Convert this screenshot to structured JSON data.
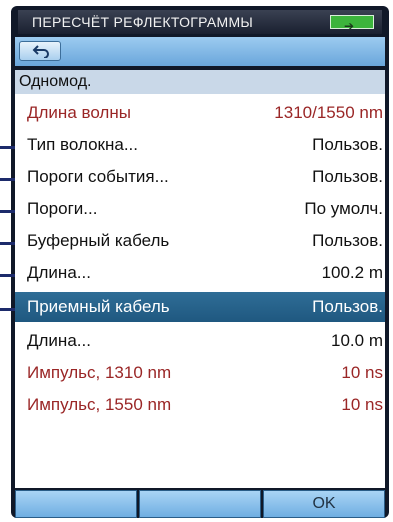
{
  "window": {
    "title": "ПЕРЕСЧЁТ РЕФЛЕКТОГРАММЫ"
  },
  "toolbar": {
    "back_icon": "back-arrow-icon"
  },
  "section": {
    "header": "Одномод."
  },
  "rows": [
    {
      "label": "Длина волны",
      "value": "1310/1550 nm"
    },
    {
      "label": "Тип волокна...",
      "value": "Пользов."
    },
    {
      "label": "Пороги события...",
      "value": "Пользов."
    },
    {
      "label": "Пороги...",
      "value": "По умолч."
    },
    {
      "label": "Буферный кабель",
      "value": "Пользов."
    },
    {
      "label": "Длина...",
      "value": "100.2 m"
    },
    {
      "label": "Приемный кабель",
      "value": "Пользов."
    },
    {
      "label": "Длина...",
      "value": "10.0 m"
    },
    {
      "label": "Импульс, 1310 nm",
      "value": "10 ns"
    },
    {
      "label": "Импульс, 1550 nm",
      "value": "10 ns"
    }
  ],
  "softkeys": [
    "",
    "",
    "OK"
  ],
  "colors": {
    "selected": "#1f5880",
    "header": "#c9d8e8",
    "red_text": "#9a2626",
    "toolbar": "#6aa6db"
  }
}
